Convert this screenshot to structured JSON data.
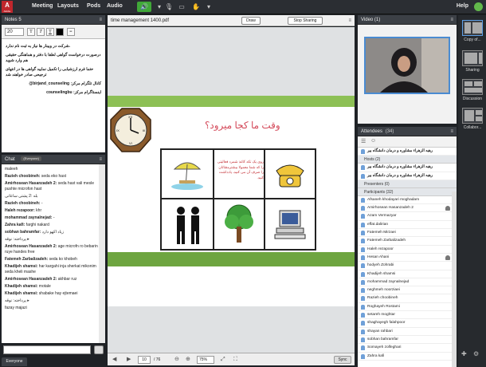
{
  "menu": [
    "Meeting",
    "Layouts",
    "Pods",
    "Audio"
  ],
  "help": "Help",
  "notes": {
    "title": "Notes 5",
    "font_size": "20",
    "fmt": [
      "T",
      "T",
      "T",
      "≡"
    ],
    "lines": [
      ".شرکت در وبینار ها نیاز به ثبت نام ندارد",
      "درصورت درخواست گواهی لطفا با دفتر و هماهنگی حقیقی هم وارد شوید",
      "حتما فرم ارزشیابی را تکمیل نمایید گواهی ها در انتهای ترجیحی صادر خواهند شد",
      "@birjand_counseling :کانال تلگرام مرکز",
      "counselingbu :اینستاگرام مرکز"
    ]
  },
  "chat": {
    "title": "Chat",
    "chip": "(Everyone)",
    "tab": "Everyone",
    "messages": [
      {
        "name": "",
        "text": "maleeh"
      },
      {
        "name": "Razieh choobineh:",
        "text": " seda eko hast"
      },
      {
        "name": "Amirhosean Hasanzadeh 2:",
        "text": " seda hast vali mesle pushte microfon hast"
      },
      {
        "name": "",
        "text": "بله :2 پشتی ساعاتی"
      },
      {
        "name": "Razieh choobineh:",
        "text": " -"
      },
      {
        "name": "Haleh rezapoor:",
        "text": " khr"
      },
      {
        "name": "mohammad zaynalnejad:",
        "text": " -"
      },
      {
        "name": "Zahra kafi:",
        "text": " farghi nakard"
      },
      {
        "name": "sobhan bahramfar:",
        "text": " زیاد اکهو دارد"
      },
      {
        "name": "",
        "text": "پرداخته: نوقه ▸"
      },
      {
        "name": "Amirhosean Hasanzadeh 2:",
        "text": " age microfn ro bebarin ruye handes free"
      },
      {
        "name": "Fatemeh Zarbalizadeh:",
        "text": " seda ko khobeh"
      },
      {
        "name": "Khadijeh shamsi:",
        "text": " har kargahi inja sherkat mikonim seda kheli mashe"
      },
      {
        "name": "Amirhosean Hasanzadeh 2:",
        "text": " akhbar ruz"
      },
      {
        "name": "Khadijeh shamsi:",
        "text": " motale"
      },
      {
        "name": "Khadijeh shamsi:",
        "text": " shabake hay ejtemaei"
      },
      {
        "name": "",
        "text": "پرداخته: نوقه ▸"
      },
      {
        "name": "",
        "text": "fazay majazi"
      }
    ]
  },
  "share": {
    "title": "time management 1400.pdf",
    "draw": "Draw",
    "stop": "Stop Sharing",
    "page": "10",
    "total": "/ 76",
    "zoom": "75%",
    "sync": "Sync",
    "slide_title": "وقت ما کجا میرود؟",
    "slide_text": "روی یک تکه کاغذ شمرد فعالیتی را که شما معمولا بیشترمقتاتان را صرف آن می کنید، یادداشت کنید."
  },
  "video": {
    "title": "Video",
    "count": "(1)"
  },
  "attendees": {
    "title": "Attendees",
    "count": "(34)",
    "top_host": "رهبه الزهراء مشاوره و درمان دانشگاه بیر",
    "hosts_label": "Hosts (2)",
    "hosts": [
      "رهبه الزهراء مشاوره و درمان دانشگاه بیر",
      "رهبه الزهراء مشاوره و درمان دانشگاه بیر"
    ],
    "presenters_label": "Presenters (0)",
    "participants_label": "Participants (32)",
    "participants": [
      "Afsaneh khodayari moghadam",
      "Amirhosean Hasanzadeh 2",
      "Azam Vermazyar",
      "effat.dalirian",
      "Fatemeh Mirzaei",
      "Fatemeh Zarbalizadeh",
      "Haleh rezapoor",
      "Hesan Ahani",
      "hodyeh Zohrabi",
      "Khadijeh shamsi",
      "mohammad zaynalnejad",
      "neghmeh noorziaei",
      "Razieh choobineh",
      "Roghayeh Rostami",
      "setareh moghtar",
      "shaghayegh falahpoor",
      "shayan rahbari",
      "sobhan bahramfar",
      "Somayeh zolfeghari",
      "Zahra kafi"
    ]
  },
  "layouts": [
    "Copy of...",
    "Sharing",
    "Discussion",
    "Collabor..."
  ]
}
